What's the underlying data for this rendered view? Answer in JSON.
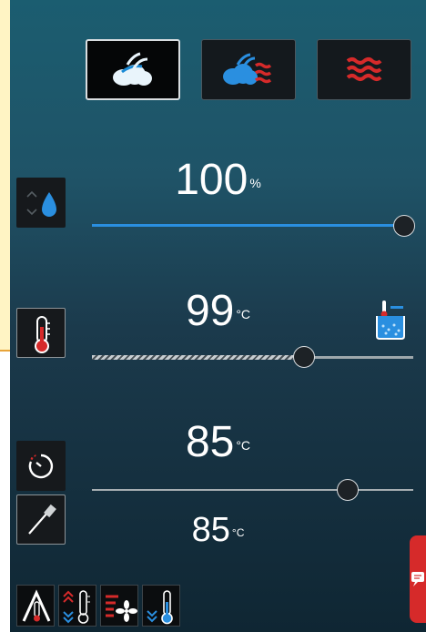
{
  "modes": [
    {
      "name": "steam",
      "active": true
    },
    {
      "name": "combi-steam",
      "active": false
    },
    {
      "name": "convection",
      "active": false
    }
  ],
  "humidity": {
    "value": "100",
    "unit": "%",
    "fraction": 1.0,
    "icon": "humidity-drop-icon"
  },
  "temperature": {
    "value": "99",
    "unit": "°C",
    "fraction": 0.68,
    "icon": "thermometer-icon",
    "aux_icon": "water-bath-icon"
  },
  "core": {
    "value": "85",
    "unit": "°C",
    "fraction": 0.82,
    "secondary_value": "85",
    "secondary_unit": "°C",
    "icons": [
      "timer-icon",
      "core-probe-icon"
    ]
  },
  "bottom_buttons": [
    "delta-t-icon",
    "thermo-updown-icon",
    "fan-heat-icon",
    "cooldown-icon"
  ],
  "colors": {
    "accent_blue": "#2a8fe0",
    "heat_red": "#d62a2a",
    "panel_top": "#1b5d70",
    "panel_bottom": "#0f2633"
  }
}
